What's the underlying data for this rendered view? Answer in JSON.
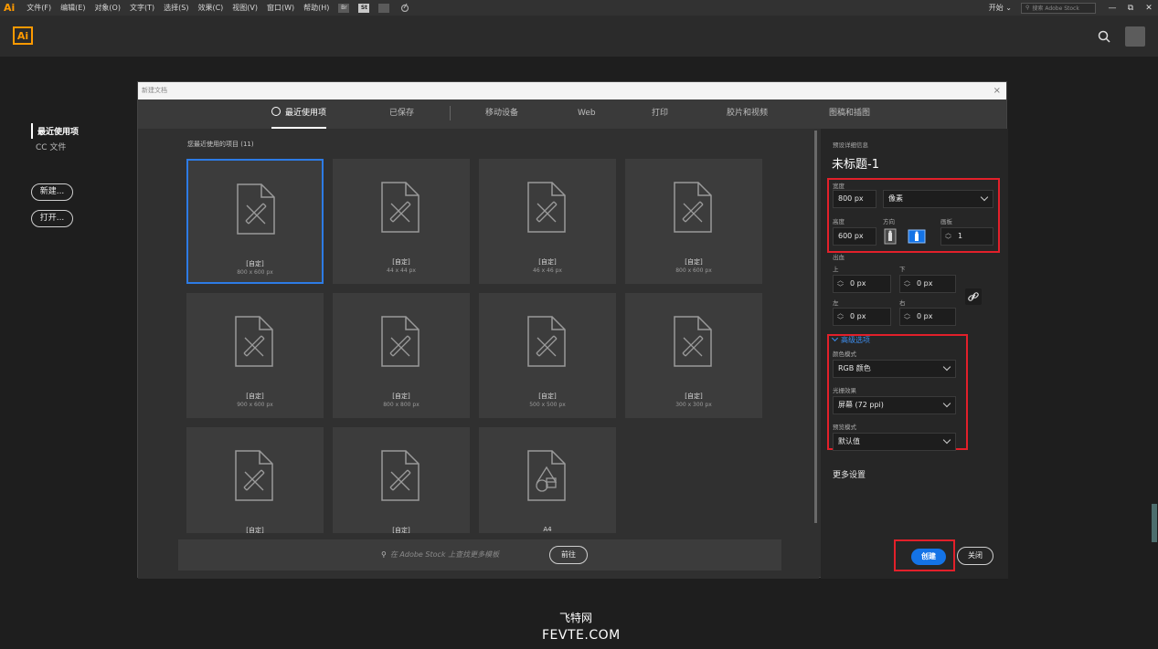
{
  "menubar": {
    "app_logo": "Ai",
    "items": [
      "文件(F)",
      "编辑(E)",
      "对象(O)",
      "文字(T)",
      "选择(S)",
      "效果(C)",
      "视图(V)",
      "窗口(W)",
      "帮助(H)"
    ],
    "icon_br": "Br",
    "icon_st": "St",
    "start": "开始 ⌄",
    "stock_search_placeholder": "搜索 Adobe Stock",
    "win_min": "—",
    "win_restore": "⧉",
    "win_close": "✕"
  },
  "appbar": {
    "logo": "Ai"
  },
  "leftnav": {
    "recent": "最近使用项",
    "cc_files": "CC 文件",
    "new_btn": "新建...",
    "open_btn": "打开..."
  },
  "dialog": {
    "title": "新建文档",
    "close": "×",
    "tabs": [
      "最近使用项",
      "已保存",
      "移动设备",
      "Web",
      "打印",
      "胶片和视频",
      "图稿和插图"
    ],
    "section_label": "您最近使用的项目 (11)",
    "cards": [
      {
        "title": "[自定]",
        "size": "800 x 600 px"
      },
      {
        "title": "[自定]",
        "size": "44 x 44 px"
      },
      {
        "title": "[自定]",
        "size": "46 x 46 px"
      },
      {
        "title": "[自定]",
        "size": "800 x 600 px"
      },
      {
        "title": "[自定]",
        "size": "900 x 600 px"
      },
      {
        "title": "[自定]",
        "size": "800 x 800 px"
      },
      {
        "title": "[自定]",
        "size": "500 x 500 px"
      },
      {
        "title": "[自定]",
        "size": "300 x 300 px"
      },
      {
        "title": "[自定]",
        "size": ""
      },
      {
        "title": "[自定]",
        "size": ""
      },
      {
        "title": "A4",
        "size": ""
      }
    ],
    "stock_placeholder": "在 Adobe Stock 上查找更多模板",
    "stock_btn": "前往"
  },
  "preset": {
    "header": "预设详细信息",
    "name": "未标题-1",
    "width_label": "宽度",
    "width": "800 px",
    "unit": "像素",
    "height_label": "高度",
    "height": "600 px",
    "orient_label": "方向",
    "artboard_label": "画板",
    "artboards": "1",
    "bleed_label": "出血",
    "top_label": "上",
    "bottom_label": "下",
    "left_label": "左",
    "right_label": "右",
    "bleed_top": "0 px",
    "bleed_bottom": "0 px",
    "bleed_left": "0 px",
    "bleed_right": "0 px",
    "advanced": "高级选项",
    "color_mode_label": "颜色模式",
    "color_mode": "RGB 颜色",
    "raster_label": "光栅效果",
    "raster": "屏幕 (72 ppi)",
    "preview_label": "预览模式",
    "preview": "默认值",
    "more": "更多设置",
    "create": "创建",
    "close": "关闭"
  },
  "watermark": {
    "cn": "飞特网",
    "en": "FEVTE.COM"
  },
  "colors": {
    "accent": "#1473e6",
    "highlight": "#e2202a",
    "ai_orange": "#ff9a00",
    "selected_card": "#2d7be5"
  }
}
